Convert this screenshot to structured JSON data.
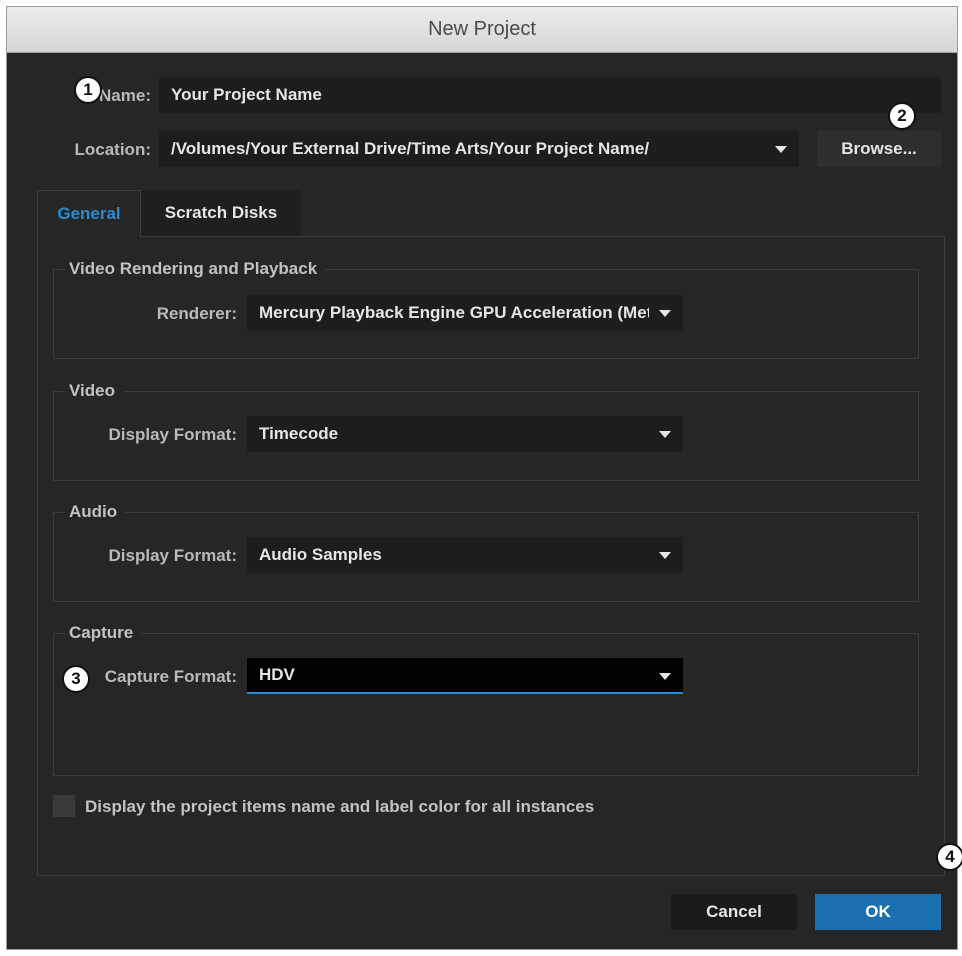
{
  "window": {
    "title": "New Project"
  },
  "name": {
    "label": "Name:",
    "value": "Your Project Name"
  },
  "location": {
    "label": "Location:",
    "value": "/Volumes/Your External Drive/Time Arts/Your Project Name/",
    "browse_label": "Browse..."
  },
  "tabs": [
    {
      "label": "General",
      "active": true
    },
    {
      "label": "Scratch Disks",
      "active": false
    }
  ],
  "sections": {
    "video_rendering": {
      "title": "Video Rendering and Playback",
      "renderer_label": "Renderer:",
      "renderer_value": "Mercury Playback Engine GPU Acceleration (Metal)"
    },
    "video": {
      "title": "Video",
      "display_format_label": "Display Format:",
      "display_format_value": "Timecode"
    },
    "audio": {
      "title": "Audio",
      "display_format_label": "Display Format:",
      "display_format_value": "Audio Samples"
    },
    "capture": {
      "title": "Capture",
      "capture_format_label": "Capture Format:",
      "capture_format_value": "HDV"
    }
  },
  "checkbox": {
    "label": "Display the project items name and label color for all instances",
    "checked": false
  },
  "buttons": {
    "cancel": "Cancel",
    "ok": "OK"
  },
  "annotations": [
    "1",
    "2",
    "3",
    "4"
  ],
  "colors": {
    "accent": "#2a8bd0",
    "ok_button": "#1a6fb0",
    "window_bg": "#262626",
    "field_bg": "#1d1d1d"
  },
  "icons": {
    "dropdown": "chevron-down-icon"
  }
}
